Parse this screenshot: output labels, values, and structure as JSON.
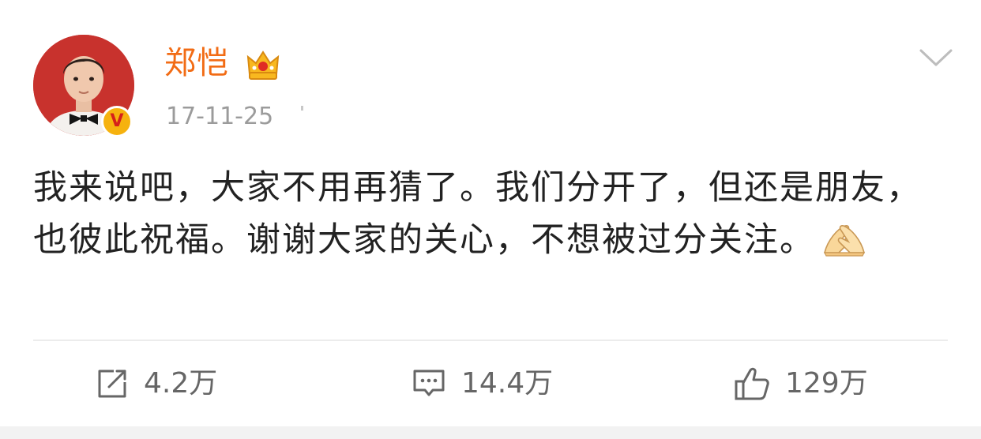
{
  "post": {
    "username": "郑恺",
    "timestamp": "17-11-25",
    "text": "我来说吧，大家不用再猜了。我们分开了，但还是朋友，也彼此祝福。谢谢大家的关心，不想被过分关注。",
    "emoji": "folded-hands-emoji"
  },
  "actions": {
    "repost_count": "4.2万",
    "comment_count": "14.4万",
    "like_count": "129万"
  },
  "icons": {
    "verified": "verified-v-icon",
    "crown": "crown-icon",
    "more": "chevron-down-icon",
    "repost": "repost-icon",
    "comment": "comment-icon",
    "like": "thumbs-up-icon"
  },
  "colors": {
    "username": "#f26c15",
    "verified_badge": "#f6b20e",
    "text": "#222222",
    "meta": "#9b9b9b"
  }
}
